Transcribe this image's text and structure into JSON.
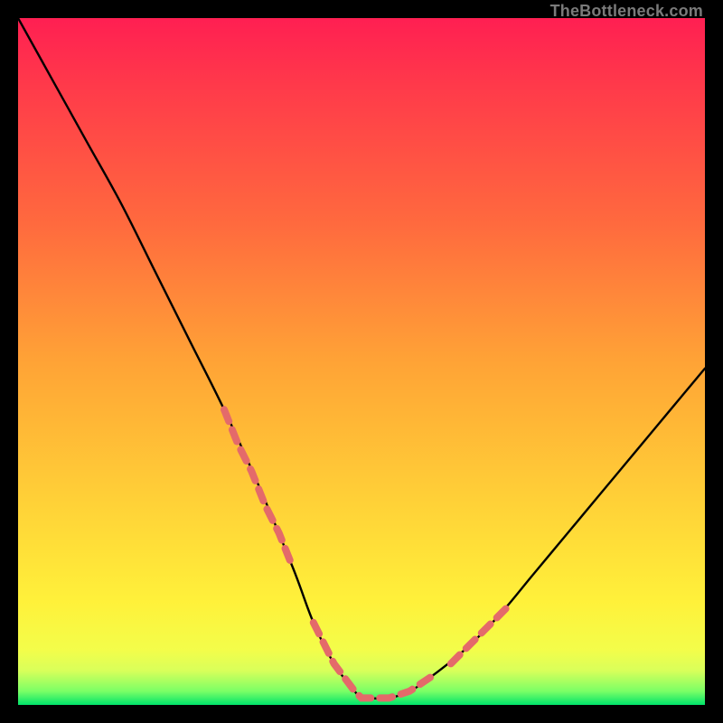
{
  "watermark": {
    "text": "TheBottleneck.com"
  },
  "chart_data": {
    "type": "line",
    "title": "",
    "xlabel": "",
    "ylabel": "",
    "xlim": [
      0,
      100
    ],
    "ylim": [
      0,
      100
    ],
    "grid": false,
    "legend": false,
    "series": [
      {
        "name": "bottleneck-curve",
        "stroke": "#000000",
        "x": [
          0,
          5,
          10,
          15,
          20,
          25,
          30,
          35,
          40,
          43,
          46,
          49,
          50,
          51,
          54,
          57,
          60,
          65,
          70,
          75,
          80,
          85,
          90,
          95,
          100
        ],
        "y": [
          100,
          91,
          82,
          73,
          63,
          53,
          43,
          32,
          20,
          12,
          6,
          2,
          1,
          1,
          1,
          2,
          4,
          8,
          13,
          19,
          25,
          31,
          37,
          43,
          49
        ]
      },
      {
        "name": "highlight-left-upper",
        "stroke": "#e46a6a",
        "dash": true,
        "x": [
          30,
          32,
          34,
          36,
          38,
          40
        ],
        "y": [
          43,
          38,
          34,
          29,
          25,
          20
        ]
      },
      {
        "name": "highlight-valley",
        "stroke": "#e46a6a",
        "dash": true,
        "x": [
          43,
          46,
          49,
          50,
          51,
          54,
          57,
          60
        ],
        "y": [
          12,
          6,
          2,
          1,
          1,
          1,
          2,
          4
        ]
      },
      {
        "name": "highlight-right-upper",
        "stroke": "#e46a6a",
        "dash": true,
        "x": [
          63,
          65,
          67,
          69,
          71
        ],
        "y": [
          6,
          8,
          10,
          12,
          14
        ]
      }
    ],
    "background_gradient": {
      "top": "#ff1f52",
      "mid_upper": "#ff6a3e",
      "mid": "#ffd037",
      "lower": "#fff13a",
      "floor": "#00e36a"
    }
  }
}
